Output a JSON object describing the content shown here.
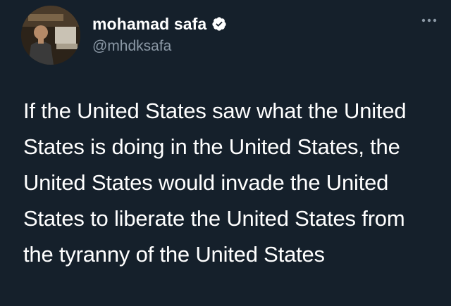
{
  "author": {
    "display_name": "mohamad safa",
    "handle": "@mhdksafa",
    "verified": true,
    "avatar_icon": "user-avatar-photo"
  },
  "tweet": {
    "text": "If the United States saw what the United States is doing in the United States, the United States would invade the United States to liberate the United States from the tyranny of the United States"
  },
  "icons": {
    "verified": "verified-badge-icon",
    "more": "more-options-icon"
  },
  "colors": {
    "background": "#15202b",
    "text_primary": "#ffffff",
    "text_secondary": "#8b98a5"
  }
}
